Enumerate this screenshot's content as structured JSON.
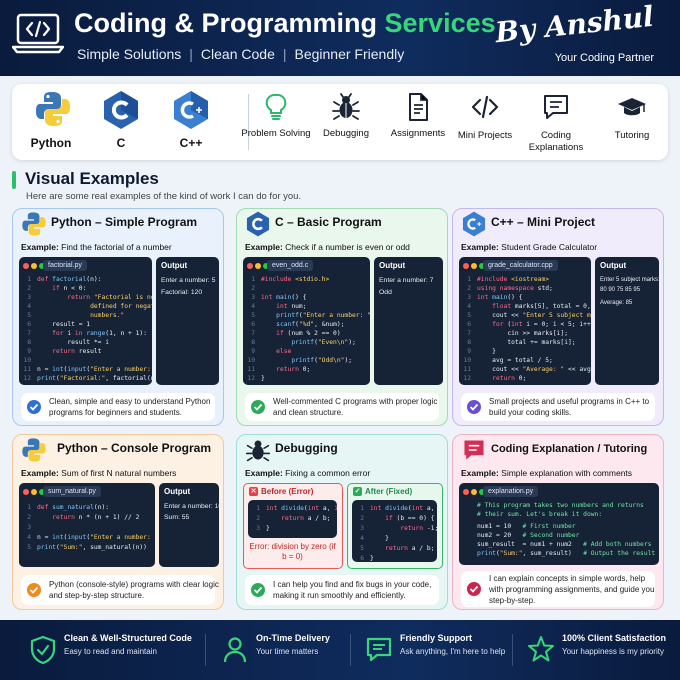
{
  "header": {
    "title_main": "Coding & Programming",
    "title_accent": "Services",
    "tagline": [
      "Simple Solutions",
      "Clean Code",
      "Beginner Friendly"
    ],
    "separator": "|",
    "author": "By Anshul",
    "author_sub": "Your Coding Partner"
  },
  "languages": [
    {
      "icon": "python-logo-icon",
      "label": "Python"
    },
    {
      "icon": "c-logo-icon",
      "label": "C"
    },
    {
      "icon": "cpp-logo-icon",
      "label": "C++"
    }
  ],
  "services": [
    {
      "icon": "lightbulb-icon",
      "label": "Problem Solving"
    },
    {
      "icon": "bug-icon",
      "label": "Debugging"
    },
    {
      "icon": "document-icon",
      "label": "Assignments"
    },
    {
      "icon": "code-brackets-icon",
      "label": "Mini Projects"
    },
    {
      "icon": "chat-icon",
      "label": "Coding Explanations"
    },
    {
      "icon": "graduation-cap-icon",
      "label": "Tutoring"
    }
  ],
  "visual": {
    "title": "Visual Examples",
    "subtitle": "Here are some real examples of the kind of work I can do for you."
  },
  "cards": {
    "python_simple": {
      "title": "Python – Simple Program",
      "example_label": "Example:",
      "example": "Find the factorial of a number",
      "filename": "factorial.py",
      "output_title": "Output",
      "output": [
        "Enter a number: 5",
        "Factorial: 120"
      ],
      "footer": "Clean, simple and easy to understand Python programs for beginners and students."
    },
    "c_basic": {
      "title": "C – Basic Program",
      "example_label": "Example:",
      "example": "Check if a number is even or odd",
      "filename": "even_odd.c",
      "output_title": "Output",
      "output": [
        "Enter a number: 7",
        "Odd"
      ],
      "footer": "Well-commented C programs with proper logic and clean structure."
    },
    "cpp_mini": {
      "title": "C++ – Mini Project",
      "example_label": "Example:",
      "example": "Student Grade Calculator",
      "filename": "grade_calculator.cpp",
      "output_title": "Output",
      "output": [
        "Enter 5 subject marks:",
        "80 90 75 85 95",
        "Average: 85"
      ],
      "footer": "Small projects and useful programs in C++ to build your coding skills."
    },
    "python_console": {
      "title": "Python – Console Program",
      "example_label": "Example:",
      "example": "Sum of first N natural numbers",
      "filename": "sum_natural.py",
      "output_title": "Output",
      "output": [
        "Enter a number: 10",
        "Sum: 55"
      ],
      "footer": "Python (console-style) programs with clear logic and step-by-step structure."
    },
    "debugging": {
      "title": "Debugging",
      "example_label": "Example:",
      "example": "Fixing a common error",
      "before_label": "Before (Error)",
      "after_label": "After (Fixed)",
      "error_text": "Error: division by zero (if b = 0)",
      "footer": "I can help you find and fix bugs in your code, making it run smoothly and efficiently."
    },
    "explanation": {
      "title": "Coding Explanation / Tutoring",
      "example_label": "Example:",
      "example": "Simple explanation with comments",
      "filename": "explanation.py",
      "footer": "I can explain concepts in simple words, help with programming assignments, and guide you step-by-step."
    }
  },
  "footer": [
    {
      "icon": "shield-check-icon",
      "title": "Clean & Well-Structured Code",
      "sub": "Easy to read and maintain"
    },
    {
      "icon": "person-icon",
      "title": "On-Time Delivery",
      "sub": "Your time matters"
    },
    {
      "icon": "support-chat-icon",
      "title": "Friendly Support",
      "sub": "Ask anything, I'm here to help"
    },
    {
      "icon": "star-icon",
      "title": "100% Client Satisfaction",
      "sub": "Your happiness is my priority"
    }
  ],
  "colors": {
    "header_bg": "#0a1b3d",
    "accent_green": "#37d67a",
    "python_card_bg": "#e8f1fc",
    "c_card_bg": "#e9f7ed",
    "cpp_card_bg": "#f0ecfb",
    "console_card_bg": "#fdf1e4",
    "debug_card_bg": "#e6f6f5",
    "tutor_card_bg": "#fce8ee"
  }
}
